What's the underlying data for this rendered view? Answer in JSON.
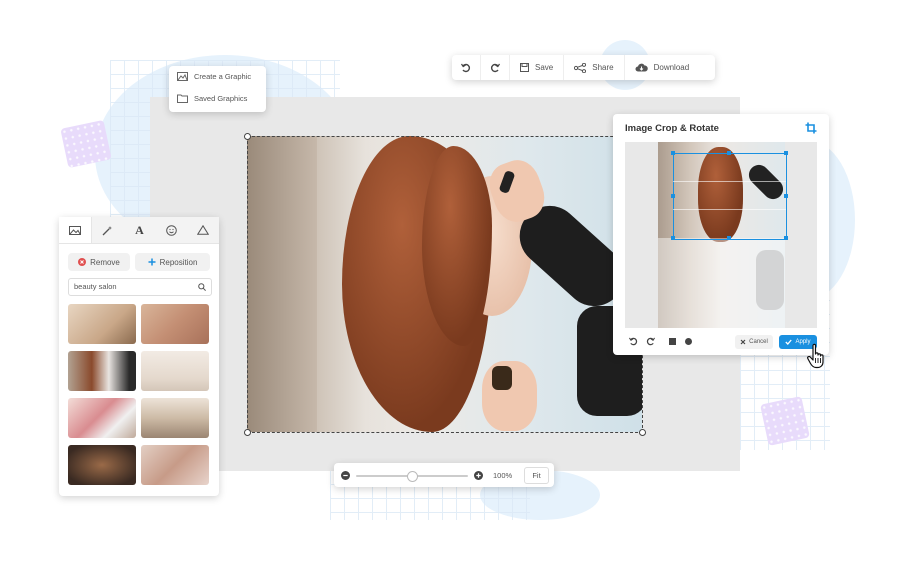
{
  "menu": {
    "create_label": "Create a Graphic",
    "saved_label": "Saved Graphics"
  },
  "toolbar": {
    "undo_icon": "undo-icon",
    "redo_icon": "redo-icon",
    "save_label": "Save",
    "share_label": "Share",
    "download_label": "Download"
  },
  "left_panel": {
    "tabs": [
      "image-icon",
      "magic-wand-icon",
      "text-icon",
      "emoji-icon",
      "shape-icon"
    ],
    "text_tab_glyph": "A",
    "remove_label": "Remove",
    "reposition_label": "Reposition",
    "search_value": "beauty salon"
  },
  "zoom": {
    "level": "100%",
    "fit_label": "Fit",
    "slider_fraction": 0.5
  },
  "crop_panel": {
    "title": "Image Crop & Rotate",
    "cancel_label": "Cancel",
    "apply_label": "Apply"
  },
  "colors": {
    "accent": "#1a90e0",
    "remove_red": "#e05050",
    "panel_bg": "#ffffff",
    "canvas_bg": "#e8e8e8"
  }
}
